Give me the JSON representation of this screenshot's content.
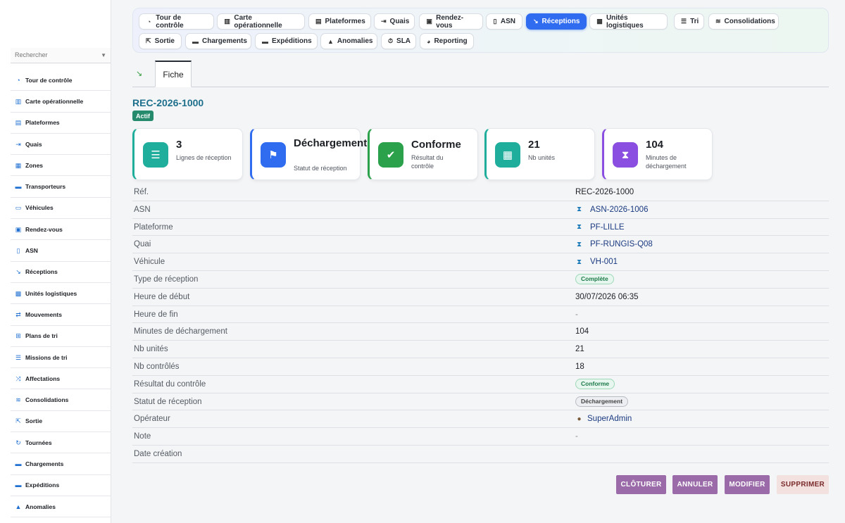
{
  "sidebar": {
    "search_placeholder": "Rechercher",
    "items": [
      {
        "label": "Tour de contrôle",
        "icon": "dashboard-icon",
        "glyph": "◔"
      },
      {
        "label": "Carte opérationnelle",
        "icon": "map-icon",
        "glyph": "▥"
      },
      {
        "label": "Plateformes",
        "icon": "warehouse-icon",
        "glyph": "▤"
      },
      {
        "label": "Quais",
        "icon": "dock-icon",
        "glyph": "⇥"
      },
      {
        "label": "Zones",
        "icon": "grid-icon",
        "glyph": "▦"
      },
      {
        "label": "Transporteurs",
        "icon": "truck-icon",
        "glyph": "▬"
      },
      {
        "label": "Véhicules",
        "icon": "bus-icon",
        "glyph": "▭"
      },
      {
        "label": "Rendez-vous",
        "icon": "calendar-icon",
        "glyph": "▣"
      },
      {
        "label": "ASN",
        "icon": "document-icon",
        "glyph": "▯"
      },
      {
        "label": "Réceptions",
        "icon": "dolly-icon",
        "glyph": "↘"
      },
      {
        "label": "Unités logistiques",
        "icon": "pallet-icon",
        "glyph": "▩"
      },
      {
        "label": "Mouvements",
        "icon": "arrows-icon",
        "glyph": "⇄"
      },
      {
        "label": "Plans de tri",
        "icon": "sitemap-icon",
        "glyph": "⊞"
      },
      {
        "label": "Missions de tri",
        "icon": "list-icon",
        "glyph": "☰"
      },
      {
        "label": "Affectations",
        "icon": "shuffle-icon",
        "glyph": "⤨"
      },
      {
        "label": "Consolidations",
        "icon": "layers-icon",
        "glyph": "≋"
      },
      {
        "label": "Sortie",
        "icon": "exit-icon",
        "glyph": "⇱"
      },
      {
        "label": "Tournées",
        "icon": "route-icon",
        "glyph": "↻"
      },
      {
        "label": "Chargements",
        "icon": "truck-loading-icon",
        "glyph": "▬"
      },
      {
        "label": "Expéditions",
        "icon": "shipping-icon",
        "glyph": "▬"
      },
      {
        "label": "Anomalies",
        "icon": "warning-icon",
        "glyph": "▲"
      }
    ]
  },
  "topnav": {
    "items": [
      {
        "label": "Tour de contrôle",
        "icon": "dashboard-icon",
        "glyph": "◔"
      },
      {
        "label": "Carte opérationnelle",
        "icon": "map-icon",
        "glyph": "▥"
      },
      {
        "label": "Plateformes",
        "icon": "warehouse-icon",
        "glyph": "▤"
      },
      {
        "label": "Quais",
        "icon": "dock-icon",
        "glyph": "⇥"
      },
      {
        "label": "Rendez-vous",
        "icon": "calendar-icon",
        "glyph": "▣"
      },
      {
        "label": "ASN",
        "icon": "document-icon",
        "glyph": "▯"
      },
      {
        "label": "Réceptions",
        "icon": "dolly-icon",
        "glyph": "↘"
      },
      {
        "label": "Unités logistiques",
        "icon": "pallet-icon",
        "glyph": "▩"
      },
      {
        "label": "Tri",
        "icon": "list-icon",
        "glyph": "☰"
      },
      {
        "label": "Consolidations",
        "icon": "layers-icon",
        "glyph": "≋"
      },
      {
        "label": "Sortie",
        "icon": "exit-icon",
        "glyph": "⇱"
      },
      {
        "label": "Chargements",
        "icon": "truck-loading-icon",
        "glyph": "▬"
      },
      {
        "label": "Expéditions",
        "icon": "shipping-icon",
        "glyph": "▬"
      },
      {
        "label": "Anomalies",
        "icon": "warning-icon",
        "glyph": "▲"
      },
      {
        "label": "SLA",
        "icon": "stopwatch-icon",
        "glyph": "⏱"
      },
      {
        "label": "Reporting",
        "icon": "pie-chart-icon",
        "glyph": "◕"
      }
    ],
    "active": "Réceptions"
  },
  "tabs": {
    "icon": "dolly-icon",
    "fiche": "Fiche"
  },
  "record": {
    "title": "REC-2026-1000",
    "status": "Actif"
  },
  "cards": [
    {
      "value": "3",
      "label": "Lignes de réception",
      "icon": "list-icon",
      "glyph": "☰",
      "color": "#1fae9c"
    },
    {
      "value": "Déchargement",
      "label": "Statut de réception",
      "icon": "flag-icon",
      "glyph": "⚑",
      "color": "#2f6cf0"
    },
    {
      "value": "Conforme",
      "label": "Résultat du contrôle",
      "icon": "clipboard-check-icon",
      "glyph": "✔",
      "color": "#2aa14a"
    },
    {
      "value": "21",
      "label": "Nb unités",
      "icon": "pallet-icon",
      "glyph": "▦",
      "color": "#1fae9c"
    },
    {
      "value": "104",
      "label": "Minutes de déchargement",
      "icon": "hourglass-icon",
      "glyph": "⧗",
      "color": "#8a4fe0"
    }
  ],
  "details": [
    {
      "key": "Réf.",
      "value": "REC-2026-1000",
      "type": "text"
    },
    {
      "key": "ASN",
      "value": "ASN-2026-1006",
      "type": "link"
    },
    {
      "key": "Plateforme",
      "value": "PF-LILLE",
      "type": "link"
    },
    {
      "key": "Quai",
      "value": "PF-RUNGIS-Q08",
      "type": "link"
    },
    {
      "key": "Véhicule",
      "value": "VH-001",
      "type": "link"
    },
    {
      "key": "Type de réception",
      "value": "Complète",
      "type": "badge-green"
    },
    {
      "key": "Heure de début",
      "value": "30/07/2026 06:35",
      "type": "text"
    },
    {
      "key": "Heure de fin",
      "value": "-",
      "type": "dash"
    },
    {
      "key": "Minutes de déchargement",
      "value": "104",
      "type": "text"
    },
    {
      "key": "Nb unités",
      "value": "21",
      "type": "text"
    },
    {
      "key": "Nb contrôlés",
      "value": "18",
      "type": "text"
    },
    {
      "key": "Résultat du contrôle",
      "value": "Conforme",
      "type": "badge-green"
    },
    {
      "key": "Statut de réception",
      "value": "Déchargement",
      "type": "badge-grey"
    },
    {
      "key": "Opérateur",
      "value": "SuperAdmin",
      "type": "user"
    },
    {
      "key": "Note",
      "value": "-",
      "type": "dash"
    },
    {
      "key": "Date création",
      "value": "",
      "type": "text"
    }
  ],
  "actions": {
    "close": "CLÔTURER",
    "cancel": "ANNULER",
    "edit": "MODIFIER",
    "delete": "SUPPRIMER"
  }
}
